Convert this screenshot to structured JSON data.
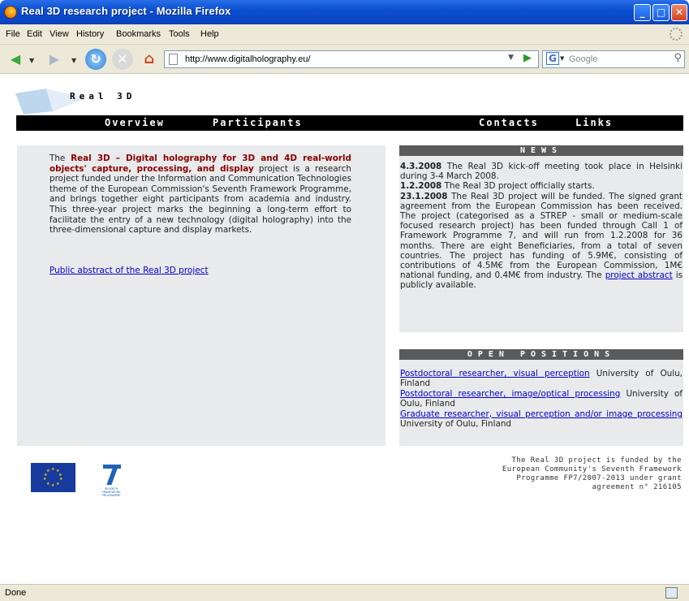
{
  "window": {
    "title": "Real 3D research project - Mozilla Firefox",
    "controls": [
      "_",
      "□",
      "✕"
    ]
  },
  "menu": {
    "items": [
      "File",
      "Edit",
      "View",
      "History",
      "Bookmarks",
      "Tools",
      "Help"
    ]
  },
  "toolbar": {
    "url": "http://www.digitalholography.eu/",
    "search_placeholder": "Google"
  },
  "site": {
    "title": "Real 3D",
    "nav": [
      "Overview",
      "Participants",
      "Contacts",
      "Links"
    ]
  },
  "intro": {
    "lead": "The ",
    "bold": "Real 3D – Digital holography for 3D and 4D real-world objects' capture, processing, and display",
    "rest": " project is a research project funded under the Information and Communication Technologies theme of the European Commission's Seventh Framework Programme, and brings together eight participants from academia and industry. This three-year project marks the beginning a long-term effort to facilitate the entry of a new technology (digital holography) into the three-dimensional capture and display markets.",
    "link": "Public abstract of the Real 3D project"
  },
  "news": {
    "heading": "NEWS",
    "items": [
      {
        "date": "4.3.2008",
        "text": " The Real 3D kick-off meeting took place in Helsinki during 3-4 March 2008."
      },
      {
        "date": "1.2.2008",
        "text": " The Real 3D project officially starts."
      },
      {
        "date": "23.1.2008",
        "text": " The Real 3D project will be funded. The signed grant agreement from the European Commission has been received. The project (categorised as a STREP - small or medium-scale focused research project) has been funded through Call 1 of Framework Programme 7, and will run from 1.2.2008 for 36 months. There are eight Beneficiaries, from a total of seven countries. The project has funding of 5.9M€, consisting of contributions of 4.5M€ from the European Commission, 1M€ national funding, and 0.4M€ from industry. The "
      }
    ],
    "link": "project abstract",
    "tail": " is publicly available."
  },
  "positions": {
    "heading": "OPEN POSITIONS",
    "items": [
      {
        "link": "Postdoctoral researcher, visual perception",
        "text": " University of Oulu, Finland"
      },
      {
        "link": "Postdoctoral researcher, image/optical processing",
        "text": " University of Oulu, Finland"
      },
      {
        "link": "Graduate researcher, visual perception and/or image processing",
        "text": " University of Oulu, Finland"
      }
    ]
  },
  "footer": {
    "funding_lines": [
      "The Real 3D project is funded by the",
      "European Community's Seventh Framework",
      "Programme FP7/2007-2013 under grant",
      "agreement n° 216105"
    ],
    "fp7_caption": "SEVENTH FRAMEWORK PROGRAMME"
  },
  "status": {
    "text": "Done"
  }
}
